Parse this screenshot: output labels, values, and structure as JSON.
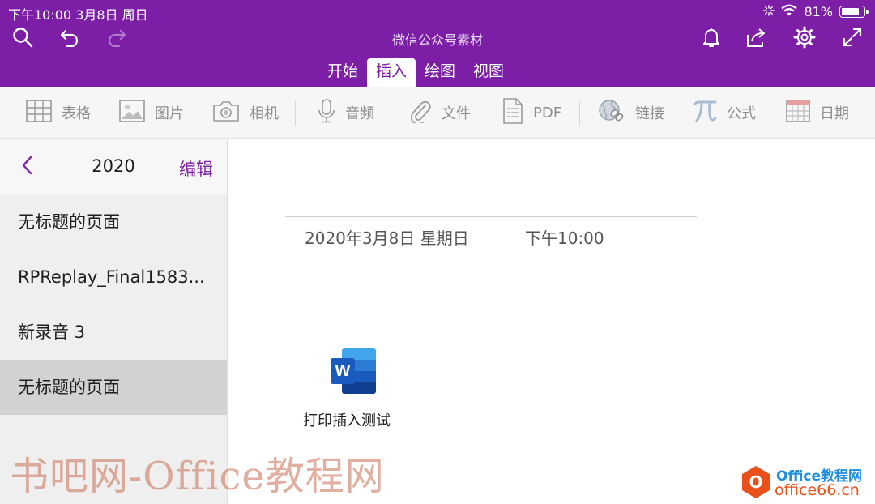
{
  "status": {
    "time_date": "下午10:00   3月8日 周日",
    "battery": "81%",
    "battery_level": 0.81
  },
  "header": {
    "notebook_title": "微信公众号素材",
    "icons_left": [
      "search-icon",
      "undo-icon",
      "redo-icon"
    ],
    "icons_right": [
      "bell-icon",
      "share-icon",
      "gear-icon",
      "fullscreen-icon"
    ]
  },
  "ribbon": {
    "tabs": [
      {
        "label": "开始",
        "active": false
      },
      {
        "label": "插入",
        "active": true
      },
      {
        "label": "绘图",
        "active": false
      },
      {
        "label": "视图",
        "active": false
      }
    ]
  },
  "toolbar": {
    "items": [
      {
        "label": "表格",
        "icon": "table-icon"
      },
      {
        "label": "图片",
        "icon": "picture-icon"
      },
      {
        "label": "相机",
        "icon": "camera-icon"
      },
      {
        "label": "音频",
        "icon": "microphone-icon"
      },
      {
        "label": "文件",
        "icon": "paperclip-icon"
      },
      {
        "label": "PDF",
        "icon": "pdf-icon"
      },
      {
        "label": "链接",
        "icon": "link-icon"
      },
      {
        "label": "公式",
        "icon": "pi-icon"
      },
      {
        "label": "日期",
        "icon": "calendar-icon"
      }
    ]
  },
  "sidebar": {
    "title": "2020",
    "edit_label": "编辑",
    "pages": [
      {
        "label": "无标题的页面",
        "selected": false
      },
      {
        "label": "RPReplay_Final1583...",
        "selected": false
      },
      {
        "label": "新录音 3",
        "selected": false
      },
      {
        "label": "无标题的页面",
        "selected": true
      }
    ]
  },
  "note": {
    "date": "2020年3月8日 星期日",
    "time": "下午10:00",
    "attachment": {
      "name": "打印插入测试",
      "icon": "word-file-icon",
      "badge": "W"
    }
  },
  "watermarks": {
    "site_text": "书吧网-Office教程网",
    "logo_line1": "Office教程网",
    "logo_line2": "office66.cn",
    "logo_mark": "O"
  },
  "colors": {
    "brand_purple": "#7c1fa6",
    "toolbar_text": "#8e8e8e",
    "selected_page": "#d2d2d2"
  }
}
